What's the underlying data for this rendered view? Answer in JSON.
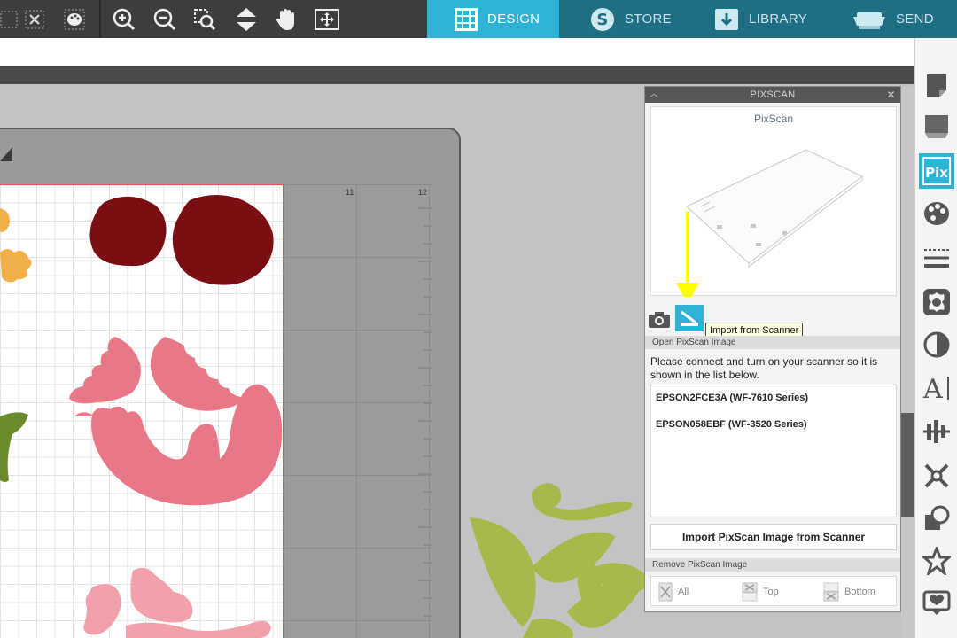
{
  "nav": {
    "tabs": [
      {
        "label": "DESIGN",
        "icon": "grid-icon",
        "active": true
      },
      {
        "label": "STORE",
        "icon": "store-s-icon",
        "active": false
      },
      {
        "label": "LIBRARY",
        "icon": "library-download-icon",
        "active": false
      },
      {
        "label": "SEND",
        "icon": "cutter-machine-icon",
        "active": false
      }
    ]
  },
  "toolbar": {
    "icons": [
      "delete-icon",
      "palette-icon",
      "zoom-in-icon",
      "zoom-out-icon",
      "zoom-selection-icon",
      "fit-to-window-icon",
      "pan-hand-icon",
      "move-icon"
    ]
  },
  "canvas": {
    "ruler_labels": [
      "11",
      "12"
    ]
  },
  "pixscan": {
    "panel_title": "PIXSCAN",
    "preview_title": "PixScan",
    "tooltip": "Import from Scanner",
    "open_section": "Open PixScan Image",
    "instructions": "Please connect and turn on your scanner so it is shown in the list below.",
    "scanners": [
      "EPSON2FCE3A (WF-7610 Series)",
      "EPSON058EBF (WF-3520 Series)"
    ],
    "import_button": "Import PixScan Image from Scanner",
    "remove_section": "Remove PixScan Image",
    "remove_buttons": [
      "All",
      "Top",
      "Bottom"
    ]
  },
  "right_tools": [
    "page-setup-icon",
    "send-panel-icon",
    "pixscan-icon",
    "fill-color-icon",
    "line-style-icon",
    "offset-icon",
    "transparency-icon",
    "text-style-icon",
    "align-icon",
    "trace-icon",
    "modify-icon",
    "library-star-icon",
    "store-icon"
  ],
  "colors": {
    "accent": "#2db3d6",
    "nav_inactive": "#1f6f84",
    "toolbar_bg": "#3d3d3d",
    "shape_dark_red": "#7a0e12",
    "shape_pink": "#e87888",
    "shape_light_pink": "#f3a0ad",
    "shape_green": "#a8b84a",
    "shape_orange": "#f2b04a",
    "annotation_yellow": "#ffff00"
  }
}
